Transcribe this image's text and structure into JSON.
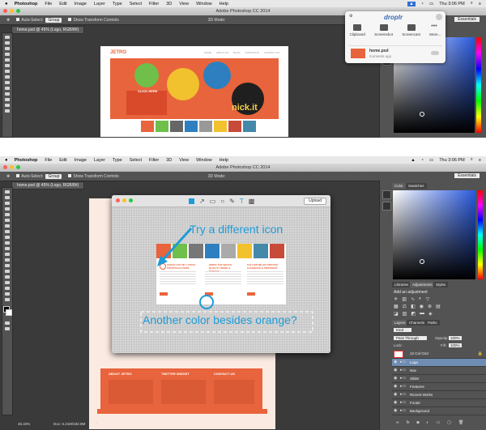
{
  "menubar": {
    "apple": "",
    "items": [
      "Photoshop",
      "File",
      "Edit",
      "Image",
      "Layer",
      "Type",
      "Select",
      "Filter",
      "3D",
      "View",
      "Window",
      "Help"
    ],
    "time": "Thu 3:06 PM"
  },
  "window_title": "Adobe Photoshop CC 2014",
  "options": {
    "auto_select": "Auto-Select:",
    "group": "Group",
    "transform": "Show Transform Controls",
    "mode3d": "3D Mode:",
    "workspace": "Essentials"
  },
  "document_tab": "home.psd @ 45% (Logo, RGB/8#)",
  "droplr": {
    "brand": "droplr",
    "actions": [
      "Clipboard",
      "Screenshot",
      "Screencast",
      "More..."
    ],
    "file_name": "home.psd",
    "file_time": "moments ago"
  },
  "site": {
    "logo": "JETRO",
    "nav": [
      "HOME",
      "ABOUT US",
      "BLOG",
      "PORTFOLIO",
      "CONTACT US"
    ],
    "hero_text": "nick.it",
    "click_here": "CLICK HERE",
    "feature1": "CHECK OUT MY LATEST PORTFOLIO ITEMS",
    "feature2": "WRITE THE WATCH QUALITY WORK & SERVICE",
    "feature3": "FOLLOW ME ON TWITTER, FACEBOOK & PINTEREST",
    "footer_about": "ABOUT JETRO",
    "footer_twitter": "TWITTER WIDGET",
    "footer_contact": "CONTACT US"
  },
  "markup": {
    "upload": "Upload",
    "annotation_icon": "Try a different icon",
    "annotation_color": "Another color besides orange?"
  },
  "panels": {
    "color_tabs": [
      "Color",
      "Swatches"
    ],
    "adj_tabs": [
      "Libraries",
      "Adjustments",
      "Styles"
    ],
    "add_adjustment": "Add an adjustment",
    "layer_tabs": [
      "Layers",
      "Channels",
      "Paths"
    ],
    "kind": "Kind",
    "blend": "Pass Through",
    "opacity_label": "Opacity:",
    "opacity": "100%",
    "lock": "Lock:",
    "fill_label": "Fill:",
    "fill": "100%",
    "layers": [
      "12 Col Grid",
      "Logo",
      "Nav",
      "Slider",
      "Features",
      "Recent Works",
      "Footer",
      "Background"
    ]
  },
  "status": {
    "zoom": "45.34%",
    "doc": "Doc: 6.21M/182.9M"
  },
  "colors": {
    "orange": "#e8643c",
    "accent_blue": "#1e9bd8",
    "app_bg": "#3a3a3a",
    "panel_bg": "#535353"
  }
}
